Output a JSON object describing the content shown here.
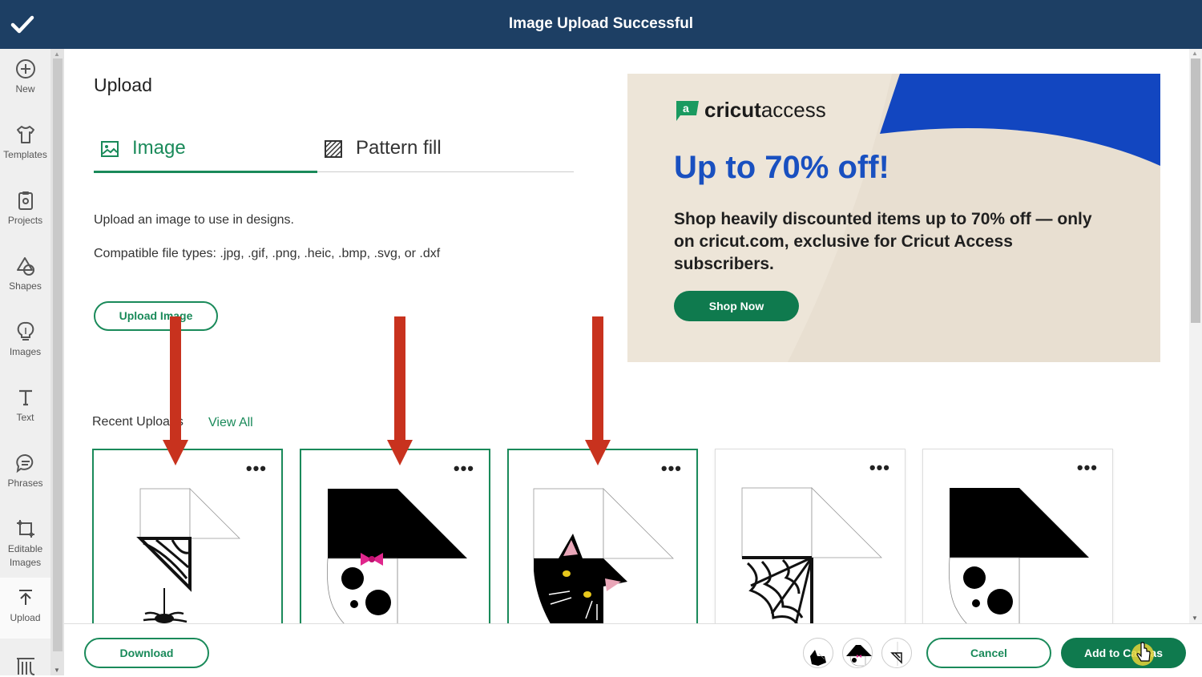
{
  "topbar": {
    "title": "Image Upload Successful",
    "icon": "check-icon"
  },
  "sidebar": {
    "items": [
      {
        "label": "New",
        "icon": "plus-circle-icon"
      },
      {
        "label": "Templates",
        "icon": "shirt-icon"
      },
      {
        "label": "Projects",
        "icon": "clipboard-icon"
      },
      {
        "label": "Shapes",
        "icon": "shapes-icon"
      },
      {
        "label": "Images",
        "icon": "lightbulb-icon"
      },
      {
        "label": "Text",
        "icon": "text-icon"
      },
      {
        "label": "Phrases",
        "icon": "speech-bubble-icon"
      },
      {
        "label": "Editable Images",
        "icon": "editable-image-icon"
      },
      {
        "label": "Upload",
        "icon": "upload-icon"
      },
      {
        "label": "",
        "icon": "monogram-icon"
      }
    ]
  },
  "main": {
    "title": "Upload",
    "tabs": [
      {
        "label": "Image",
        "icon": "image-icon",
        "active": true
      },
      {
        "label": "Pattern fill",
        "icon": "pattern-icon",
        "active": false
      }
    ],
    "description": "Upload an image to use in designs.",
    "file_types": "Compatible file types: .jpg, .gif, .png, .heic, .bmp, .svg, or .dxf",
    "upload_button": "Upload Image",
    "recent_label": "Recent Uploads",
    "view_all": "View All"
  },
  "ad": {
    "brand": "cricut",
    "brand_suffix": "access",
    "brand_mark": "a",
    "headline": "Up to 70% off!",
    "body": "Shop heavily discounted items up to 70% off — only on cricut.com, exclusive for Cricut Access subscribers.",
    "cta": "Shop Now"
  },
  "recent_uploads": [
    {
      "name": "spider-web-outline",
      "selected": true,
      "more": "•••"
    },
    {
      "name": "skull-black-bow",
      "selected": true,
      "more": "•••"
    },
    {
      "name": "black-cat",
      "selected": true,
      "more": "•••"
    },
    {
      "name": "spider-web-corner",
      "selected": false,
      "more": "•••"
    },
    {
      "name": "skull-black",
      "selected": false,
      "more": "•••"
    }
  ],
  "bottom": {
    "download": "Download",
    "cancel": "Cancel",
    "add": "Add to Canvas"
  },
  "colors": {
    "topbar": "#1d3f64",
    "accent": "#1a8a5a",
    "cta": "#0f7a4e",
    "ad_headline": "#1950c0",
    "arrow": "#c8321e"
  }
}
